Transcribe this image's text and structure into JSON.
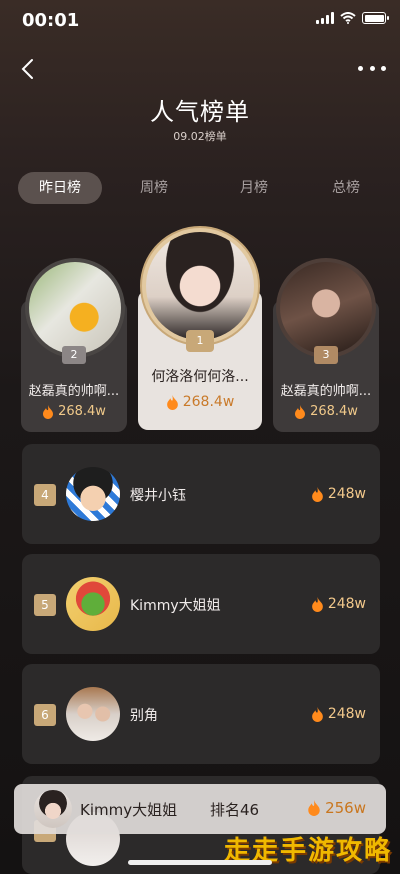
{
  "status": {
    "time": "00:01"
  },
  "header": {
    "title": "人气榜单",
    "subtitle": "09.02榜单"
  },
  "tabs": [
    {
      "label": "昨日榜",
      "active": true
    },
    {
      "label": "周榜",
      "active": false
    },
    {
      "label": "月榜",
      "active": false
    },
    {
      "label": "总榜",
      "active": false
    }
  ],
  "podium": {
    "first": {
      "rank": "1",
      "name": "何洛洛何何洛...",
      "score": "268.4w"
    },
    "second": {
      "rank": "2",
      "name": "赵磊真的帅啊...",
      "score": "268.4w"
    },
    "third": {
      "rank": "3",
      "name": "赵磊真的帅啊...",
      "score": "268.4w"
    }
  },
  "list": [
    {
      "rank": "4",
      "name": "樱井小钰",
      "score": "248w"
    },
    {
      "rank": "5",
      "name": "Kimmy大姐姐",
      "score": "248w"
    },
    {
      "rank": "6",
      "name": "别角",
      "score": "248w"
    }
  ],
  "my_rank": {
    "name": "Kimmy大姐姐",
    "rank": "排名46",
    "score": "256w"
  },
  "watermark": "走走手游攻略",
  "colors": {
    "accent_gold": "#c8a878",
    "score_orange": "#f3c98c",
    "flame": "#ff8a1c"
  },
  "icons": [
    "back-chevron-icon",
    "more-dots-icon",
    "flame-icon",
    "medal-icon",
    "signal-icon",
    "wifi-icon",
    "battery-icon"
  ]
}
